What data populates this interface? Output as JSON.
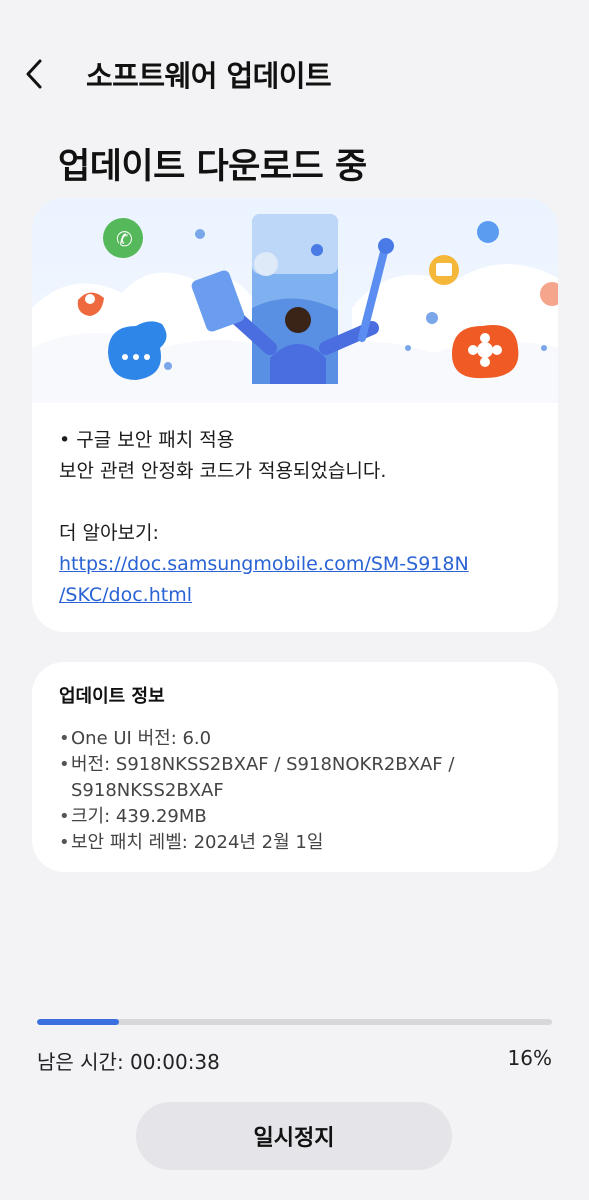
{
  "header": {
    "title": "소프트웨어 업데이트"
  },
  "page_title": "업데이트 다운로드 중",
  "notes": {
    "bullet": "• 구글 보안 패치 적용",
    "description": "보안 관련 안정화 코드가 적용되었습니다.",
    "learn_more": "더 알아보기:",
    "link_line1": "https://doc.samsungmobile.com/SM-S918N",
    "link_line2": "/SKC/doc.html"
  },
  "info": {
    "title": "업데이트 정보",
    "items": [
      "One UI 버전: 6.0",
      "버전: S918NKSS2BXAF / S918NOKR2BXAF /\nS918NKSS2BXAF",
      "크기: 439.29MB",
      "보안 패치 레벨: 2024년 2월 1일"
    ]
  },
  "progress": {
    "time_left": "남은 시간: 00:00:38",
    "percent_label": "16%",
    "fraction": 0.16
  },
  "pause_button": "일시정지",
  "colors": {
    "accent": "#3b6fe0",
    "link": "#2a63d4"
  }
}
